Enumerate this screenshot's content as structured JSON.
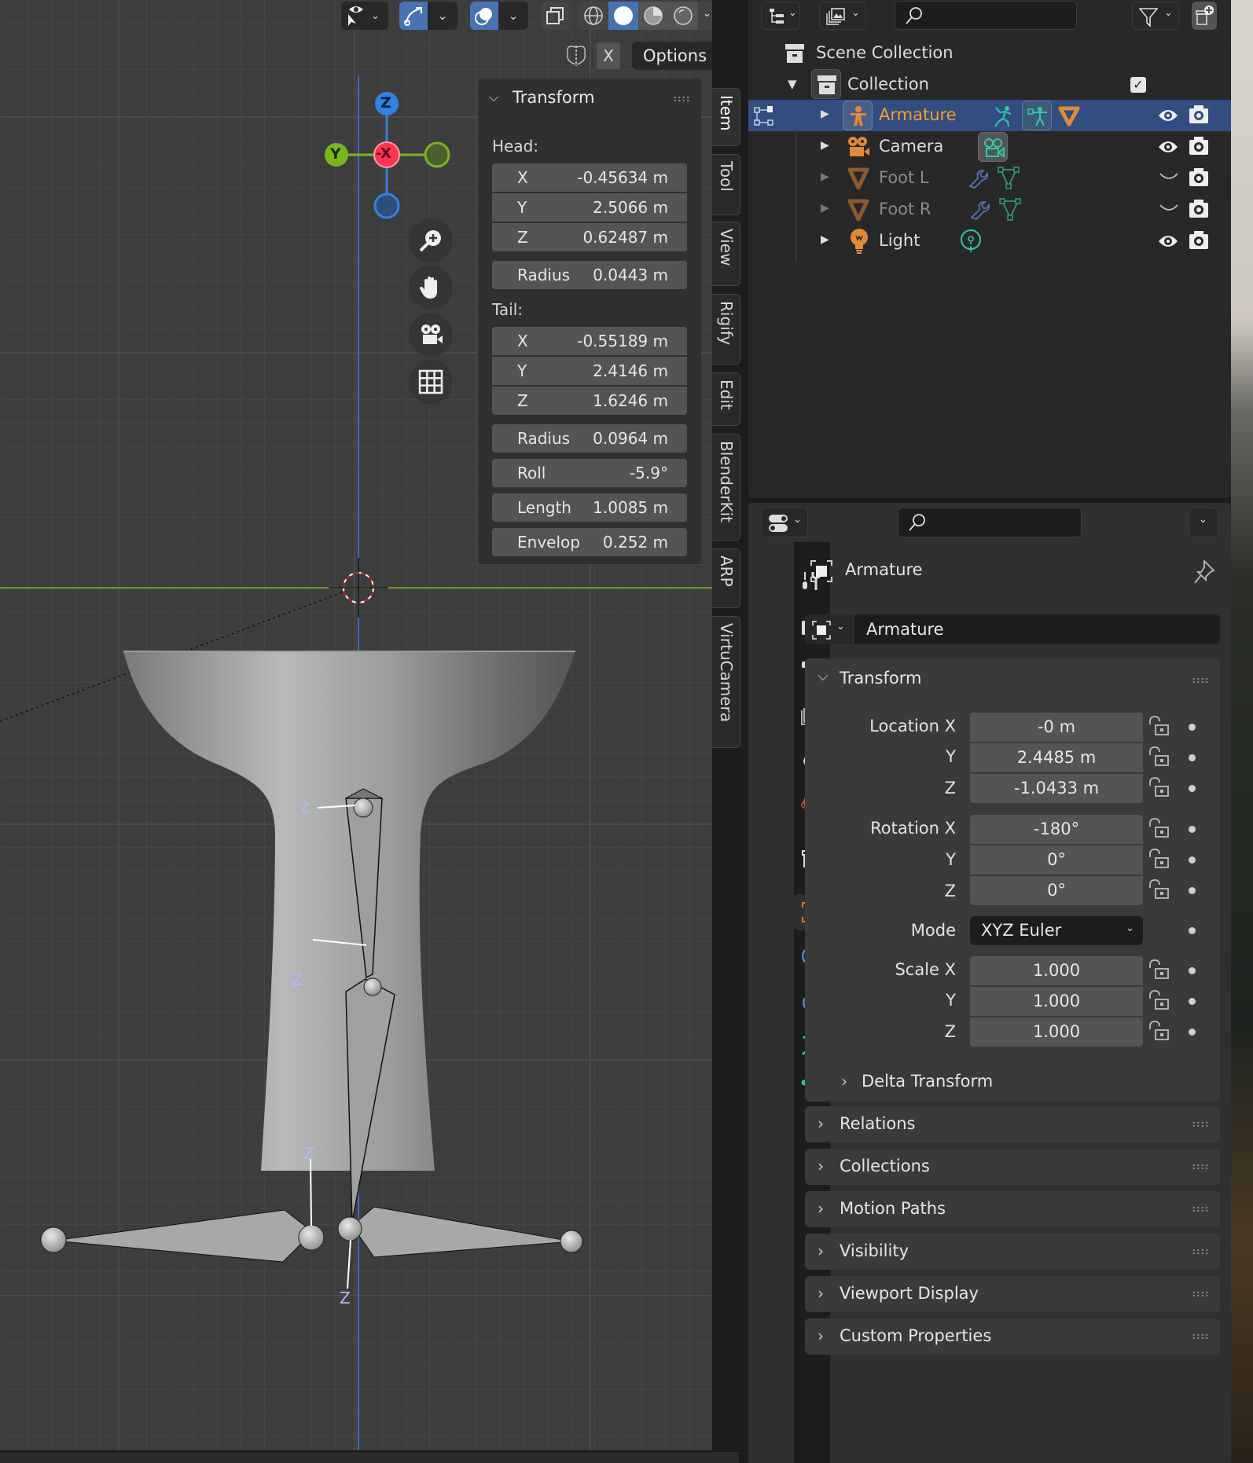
{
  "viewport": {
    "toolbar": {
      "selectability_icon": "eye-cursor-icon",
      "gizmo_icon": "gizmo-arrow-icon",
      "overlay_icon": "overlay-circles-icon",
      "xray_icon": "xray-icon",
      "shading_modes": [
        "wireframe",
        "solid",
        "material-preview",
        "rendered"
      ],
      "active_shading": "solid"
    },
    "mirror_axis_label": "X",
    "options_label": "Options",
    "nav_gizmo": {
      "z": "Z",
      "y": "Y",
      "neg_x": "-X"
    },
    "bone_axis_labels": [
      "Z",
      "Z",
      "Z",
      "Z"
    ],
    "npanel": {
      "title": "Transform",
      "head_label": "Head:",
      "head": [
        {
          "key": "X",
          "value": "-0.45634 m"
        },
        {
          "key": "Y",
          "value": "2.5066 m"
        },
        {
          "key": "Z",
          "value": "0.62487 m"
        }
      ],
      "head_radius": {
        "key": "Radius",
        "value": "0.0443 m"
      },
      "tail_label": "Tail:",
      "tail": [
        {
          "key": "X",
          "value": "-0.55189 m"
        },
        {
          "key": "Y",
          "value": "2.4146 m"
        },
        {
          "key": "Z",
          "value": "1.6246 m"
        }
      ],
      "tail_radius": {
        "key": "Radius",
        "value": "0.0964 m"
      },
      "roll": {
        "key": "Roll",
        "value": "-5.9°"
      },
      "length": {
        "key": "Length",
        "value": "1.0085 m"
      },
      "envelope": {
        "key": "Envelop",
        "value": "0.252 m"
      }
    },
    "sidebar_tabs": [
      "Item",
      "Tool",
      "View",
      "Rigify",
      "Edit",
      "BlenderKit",
      "ARP",
      "VirtuCamera"
    ],
    "active_sidebar_tab": "Item"
  },
  "outliner": {
    "search_placeholder": "",
    "scene_collection": "Scene Collection",
    "collection": "Collection",
    "items": [
      {
        "name": "Armature",
        "selected": true
      },
      {
        "name": "Camera",
        "selected": false
      },
      {
        "name": "Foot L",
        "selected": false,
        "hidden": true
      },
      {
        "name": "Foot R",
        "selected": false,
        "hidden": true
      },
      {
        "name": "Light",
        "selected": false
      }
    ]
  },
  "properties": {
    "search_placeholder": "",
    "object_title": "Armature",
    "object_name": "Armature",
    "transform_title": "Transform",
    "location": {
      "label": "Location X",
      "x": "-0 m",
      "y": "2.4485 m",
      "z": "-1.0433 m"
    },
    "rotation": {
      "label": "Rotation X",
      "x": "-180°",
      "y": "0°",
      "z": "0°"
    },
    "mode": {
      "label": "Mode",
      "value": "XYZ Euler"
    },
    "scale": {
      "label": "Scale X",
      "x": "1.000",
      "y": "1.000",
      "z": "1.000"
    },
    "axis_labels": {
      "y": "Y",
      "z": "Z"
    },
    "delta_transform": "Delta Transform",
    "sections": [
      "Relations",
      "Collections",
      "Motion Paths",
      "Visibility",
      "Viewport Display",
      "Custom Properties"
    ]
  },
  "colors": {
    "accent": "#4772b3",
    "selected_row": "#334d80",
    "armature_orange": "#f0a030",
    "object_orange": "#e08a3c",
    "teal": "#2ec8a8",
    "axis_x": "#ff3352",
    "axis_y": "#8bdc00",
    "axis_z": "#2f83e3"
  }
}
